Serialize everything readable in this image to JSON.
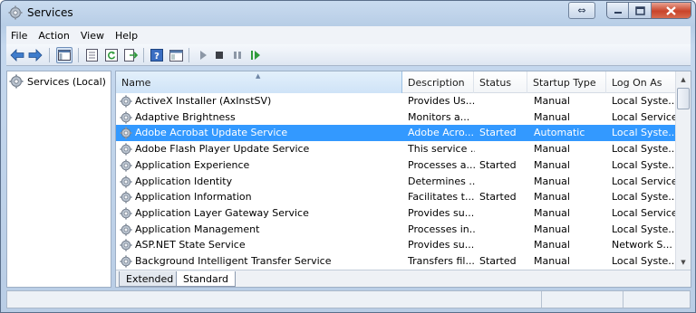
{
  "window": {
    "title": "Services"
  },
  "menu": [
    "File",
    "Action",
    "View",
    "Help"
  ],
  "tree": {
    "root_label": "Services (Local)"
  },
  "columns": [
    "Name",
    "Description",
    "Status",
    "Startup Type",
    "Log On As"
  ],
  "services": [
    {
      "name": "ActiveX Installer (AxInstSV)",
      "description": "Provides Us...",
      "status": "",
      "startup": "Manual",
      "logon": "Local Syste..."
    },
    {
      "name": "Adaptive Brightness",
      "description": "Monitors a...",
      "status": "",
      "startup": "Manual",
      "logon": "Local Service"
    },
    {
      "name": "Adobe Acrobat Update Service",
      "description": "Adobe Acro...",
      "status": "Started",
      "startup": "Automatic",
      "logon": "Local Syste..."
    },
    {
      "name": "Adobe Flash Player Update Service",
      "description": "This service ...",
      "status": "",
      "startup": "Manual",
      "logon": "Local Syste..."
    },
    {
      "name": "Application Experience",
      "description": "Processes a...",
      "status": "Started",
      "startup": "Manual",
      "logon": "Local Syste..."
    },
    {
      "name": "Application Identity",
      "description": "Determines ...",
      "status": "",
      "startup": "Manual",
      "logon": "Local Service"
    },
    {
      "name": "Application Information",
      "description": "Facilitates t...",
      "status": "Started",
      "startup": "Manual",
      "logon": "Local Syste..."
    },
    {
      "name": "Application Layer Gateway Service",
      "description": "Provides su...",
      "status": "",
      "startup": "Manual",
      "logon": "Local Service"
    },
    {
      "name": "Application Management",
      "description": "Processes in...",
      "status": "",
      "startup": "Manual",
      "logon": "Local Syste..."
    },
    {
      "name": "ASP.NET State Service",
      "description": "Provides su...",
      "status": "",
      "startup": "Manual",
      "logon": "Network S..."
    },
    {
      "name": "Background Intelligent Transfer Service",
      "description": "Transfers fil...",
      "status": "Started",
      "startup": "Manual",
      "logon": "Local Syste..."
    }
  ],
  "selected_index": 2,
  "tabs": [
    "Extended",
    "Standard"
  ],
  "active_tab": "Standard",
  "toolbar_icons": [
    "back-arrow-icon",
    "forward-arrow-icon",
    "show-hide-tree-icon",
    "properties-icon",
    "refresh-icon",
    "export-list-icon",
    "help-icon",
    "console-icon",
    "start-service-icon",
    "stop-service-icon",
    "pause-service-icon",
    "resume-service-icon"
  ],
  "colors": {
    "selection": "#3399ff",
    "title_gradient": "#c9dbef",
    "close_button": "#c9442a"
  }
}
